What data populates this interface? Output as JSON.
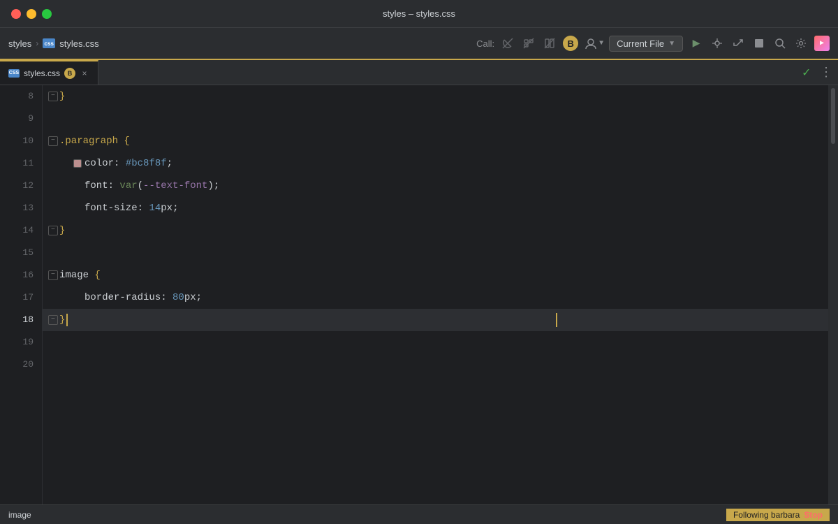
{
  "titleBar": {
    "title": "styles – styles.css"
  },
  "navBar": {
    "breadcrumb": {
      "project": "styles",
      "separator": "›",
      "cssIconLabel": "css",
      "file": "styles.css"
    },
    "callLabel": "Call:",
    "currentFileLabel": "Current File",
    "runButton": "▶",
    "debugIcons": [
      "🐛",
      "↩",
      "⏹"
    ],
    "searchLabel": "🔍",
    "gearLabel": "⚙",
    "colorLabel": "🎨"
  },
  "tabs": [
    {
      "cssIconLabel": "CSS",
      "name": "styles.css",
      "modified": "B",
      "close": "×"
    }
  ],
  "checkmark": "✓",
  "moreOptions": "⋮",
  "codeLines": [
    {
      "num": 8,
      "content": "}",
      "type": "close-brace"
    },
    {
      "num": 9,
      "content": "",
      "type": "empty"
    },
    {
      "num": 10,
      "content": ".paragraph {",
      "type": "selector"
    },
    {
      "num": 11,
      "content": "    color: #bc8f8f;",
      "type": "property-color"
    },
    {
      "num": 12,
      "content": "    font: var(--text-font);",
      "type": "property-var"
    },
    {
      "num": 13,
      "content": "    font-size: 14px;",
      "type": "property-size"
    },
    {
      "num": 14,
      "content": "}",
      "type": "close-brace-fold"
    },
    {
      "num": 15,
      "content": "",
      "type": "empty"
    },
    {
      "num": 16,
      "content": "image {",
      "type": "selector-image"
    },
    {
      "num": 17,
      "content": "    border-radius: 80px;",
      "type": "property-radius"
    },
    {
      "num": 18,
      "content": "} ",
      "type": "close-brace-cursor"
    },
    {
      "num": 19,
      "content": "",
      "type": "empty"
    },
    {
      "num": 20,
      "content": "",
      "type": "empty"
    }
  ],
  "statusBar": {
    "left": "image",
    "followText": "Following barbara",
    "stopText": "Stop"
  },
  "colors": {
    "accent": "#c8a84b",
    "background": "#1e1f22",
    "navBg": "#2b2d30",
    "tabBorderTop": "#c8a84b",
    "checkmark": "#4caf50",
    "selectorColor": "#c8a84b",
    "propertyColor": "#cdd1d5",
    "valueColor": "#6897bb",
    "hashColor": "#bc8f8f",
    "varColor": "#9876aa",
    "greenColor": "#6a8759",
    "statusFollow": "#c8a84b"
  }
}
